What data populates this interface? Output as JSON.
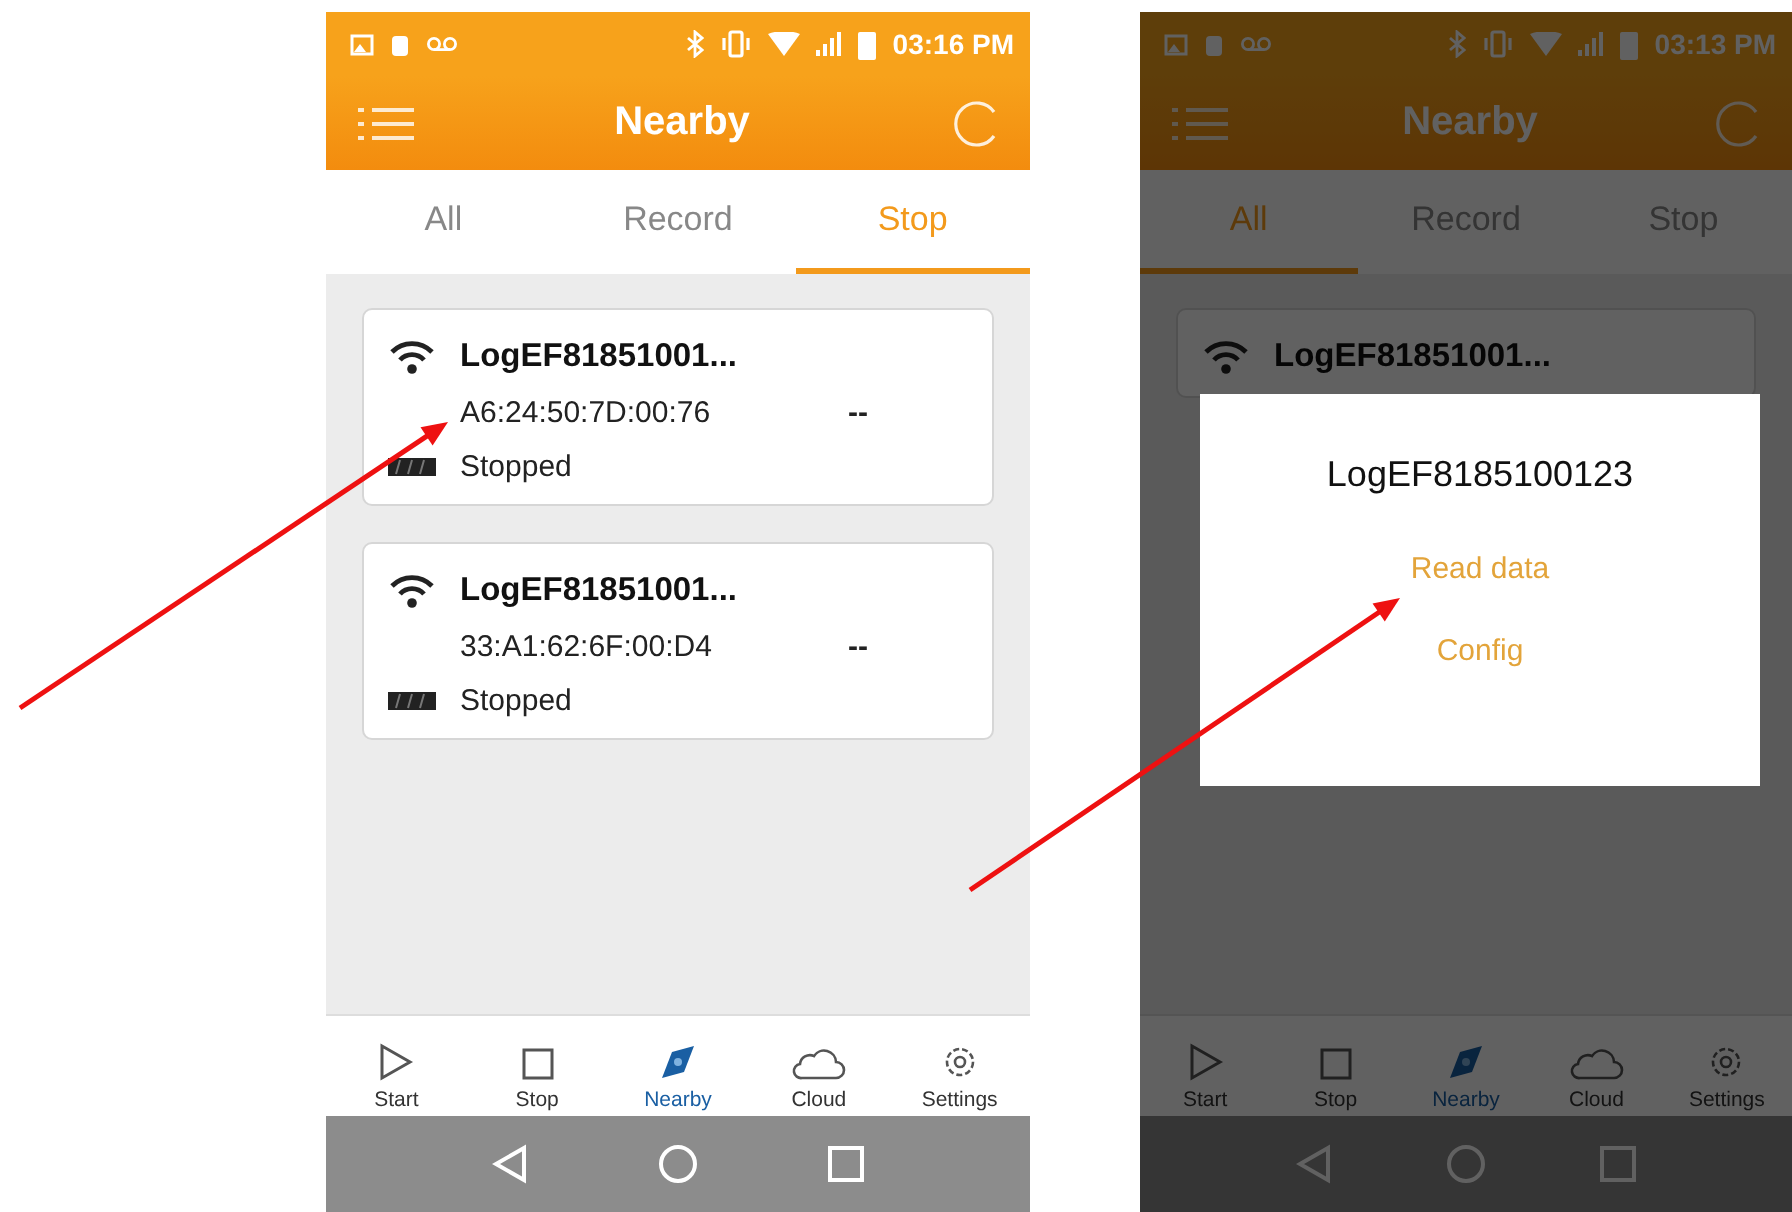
{
  "screens": [
    {
      "status_bar": {
        "time": "03:16 PM"
      },
      "title": "Nearby",
      "tabs": [
        {
          "label": "All",
          "selected": false
        },
        {
          "label": "Record",
          "selected": false
        },
        {
          "label": "Stop",
          "selected": true
        }
      ],
      "devices": [
        {
          "name": "LogEF81851001...",
          "address": "A6:24:50:7D:00:76",
          "reading": "--",
          "status": "Stopped"
        },
        {
          "name": "LogEF81851001...",
          "address": "33:A1:62:6F:00:D4",
          "reading": "--",
          "status": "Stopped"
        }
      ],
      "bottom_nav": [
        {
          "label": "Start",
          "selected": false
        },
        {
          "label": "Stop",
          "selected": false
        },
        {
          "label": "Nearby",
          "selected": true
        },
        {
          "label": "Cloud",
          "selected": false
        },
        {
          "label": "Settings",
          "selected": false
        }
      ]
    },
    {
      "status_bar": {
        "time": "03:13 PM"
      },
      "title": "Nearby",
      "dimmed": true,
      "tabs": [
        {
          "label": "All",
          "selected": true
        },
        {
          "label": "Record",
          "selected": false
        },
        {
          "label": "Stop",
          "selected": false
        }
      ],
      "devices": [
        {
          "name": "LogEF81851001..."
        }
      ],
      "dialog": {
        "title": "LogEF8185100123",
        "actions": [
          "Read data",
          "Config"
        ]
      },
      "bottom_nav": [
        {
          "label": "Start",
          "selected": false
        },
        {
          "label": "Stop",
          "selected": false
        },
        {
          "label": "Nearby",
          "selected": true
        },
        {
          "label": "Cloud",
          "selected": false
        },
        {
          "label": "Settings",
          "selected": false
        }
      ]
    }
  ]
}
